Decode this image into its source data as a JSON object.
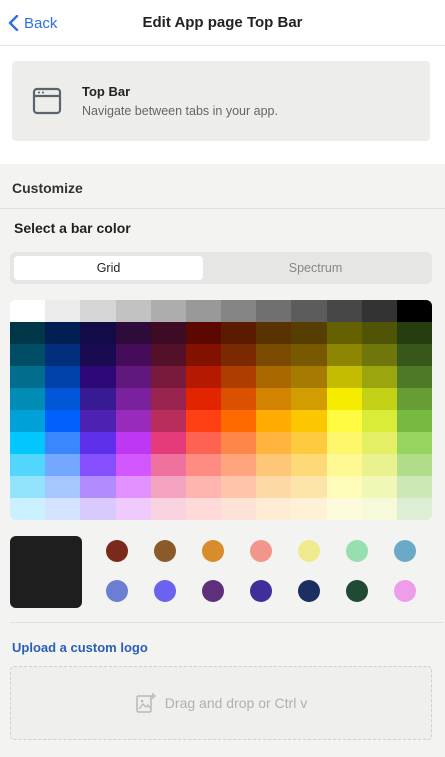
{
  "header": {
    "back_label": "Back",
    "title": "Edit App page Top Bar"
  },
  "component": {
    "name": "Top Bar",
    "description": "Navigate between tabs in your app.",
    "icon": "browser-window-icon"
  },
  "customize_label": "Customize",
  "select_label": "Select a bar color",
  "tabs": [
    {
      "label": "Grid",
      "active": true
    },
    {
      "label": "Spectrum",
      "active": false
    }
  ],
  "palette": {
    "rows": [
      [
        "#ffffff",
        "#ebebeb",
        "#d6d6d6",
        "#c2c2c2",
        "#adadad",
        "#999999",
        "#858585",
        "#707070",
        "#5c5c5c",
        "#474747",
        "#333333",
        "#000000"
      ],
      [
        "#003748",
        "#021f54",
        "#120b47",
        "#2d0b3b",
        "#3d0b23",
        "#5c0700",
        "#5a1b00",
        "#583300",
        "#563d00",
        "#666100",
        "#4f5504",
        "#263e0f"
      ],
      [
        "#004d65",
        "#012f7b",
        "#1a0a52",
        "#450d59",
        "#551029",
        "#831100",
        "#7b2900",
        "#7a4a00",
        "#785800",
        "#8c8602",
        "#6f760a",
        "#38571a"
      ],
      [
        "#016e8f",
        "#0042a9",
        "#2c0977",
        "#61187c",
        "#791a3d",
        "#b51a00",
        "#ad3e00",
        "#a96800",
        "#a67b01",
        "#c4bc00",
        "#9ba50e",
        "#4e7a27"
      ],
      [
        "#008cb4",
        "#0056d6",
        "#371a94",
        "#7a219e",
        "#99244f",
        "#e22400",
        "#da5100",
        "#d38301",
        "#d19d01",
        "#f5ec00",
        "#c3d117",
        "#669d34"
      ],
      [
        "#00a1d8",
        "#0061fd",
        "#4d22b2",
        "#982abc",
        "#b92d5d",
        "#ff4015",
        "#ff6a00",
        "#ffab01",
        "#fcc700",
        "#fefb41",
        "#d9ec37",
        "#76bb40"
      ],
      [
        "#01c7fc",
        "#3a87fd",
        "#5e30eb",
        "#be38f3",
        "#e63b7a",
        "#fe6250",
        "#fe8648",
        "#feb43f",
        "#fecb3e",
        "#fff76b",
        "#e4ef65",
        "#96d35f"
      ],
      [
        "#52d6fc",
        "#74a7ff",
        "#864ffd",
        "#d357fe",
        "#ee719e",
        "#ff8c82",
        "#fea57d",
        "#fec777",
        "#fed977",
        "#fff994",
        "#eaf28f",
        "#b1dd8b"
      ],
      [
        "#93e3fc",
        "#a7c6ff",
        "#b18cfe",
        "#e292fe",
        "#f4a4c0",
        "#ffb5af",
        "#ffc5ab",
        "#fed9a8",
        "#fde4a8",
        "#fffbb9",
        "#f1f7b7",
        "#cde8b5"
      ],
      [
        "#cbf0ff",
        "#d3e2ff",
        "#d9c9fe",
        "#efcaff",
        "#f9d3e0",
        "#ffdad8",
        "#ffe2d6",
        "#feecd4",
        "#fef1d5",
        "#fdfbdd",
        "#f6fadb",
        "#deeed4"
      ]
    ],
    "selected": "#1e1e1e",
    "presets": [
      [
        "#7a2a1a",
        "#8a5a2a",
        "#d98c2b",
        "#f2958a",
        "#f0ea8e",
        "#97dfae",
        "#6aa9c8"
      ],
      [
        "#6b7ed2",
        "#6b63f0",
        "#5e2f7a",
        "#3f2f9a",
        "#1c2f63",
        "#1f4a33",
        "#ee9de8"
      ]
    ]
  },
  "upload": {
    "label": "Upload a custom logo",
    "drop_text": "Drag and drop or Ctrl v",
    "icon": "image-plus-icon"
  }
}
